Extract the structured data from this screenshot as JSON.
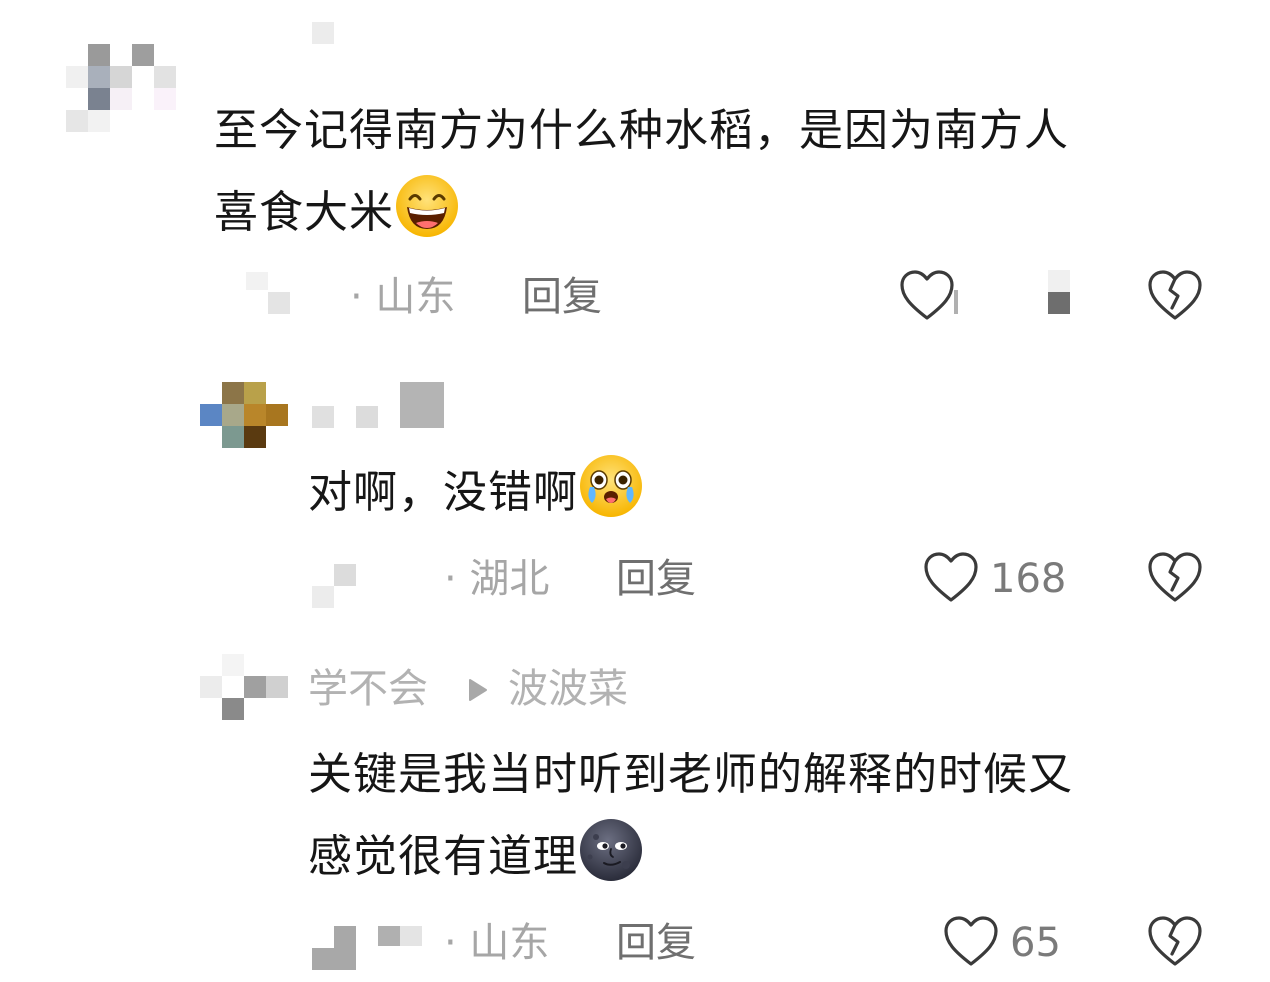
{
  "comments": [
    {
      "text_line1": "至今记得南方为什么种水稻，是因为南方人",
      "text_line2": "喜食大米",
      "emoji": "grinning-squinting-face",
      "location": "· 山东",
      "reply_label": "回复",
      "like_count": ""
    },
    {
      "text_line1": "对啊，没错啊",
      "emoji": "face-holding-back-tears",
      "location": "· 湖北",
      "reply_label": "回复",
      "like_count": "168"
    },
    {
      "reply_from": "学不会",
      "reply_to": "波波菜",
      "text_line1": "关键是我当时听到老师的解释的时候又",
      "text_line2": "感觉很有道理",
      "emoji": "new-moon-face",
      "location": "· 山东",
      "reply_label": "回复",
      "like_count": "65"
    }
  ],
  "colors": {
    "text": "#161616",
    "meta": "#a6a6a6",
    "reply": "#6f6f6f",
    "icon": "#3a3a3a"
  }
}
